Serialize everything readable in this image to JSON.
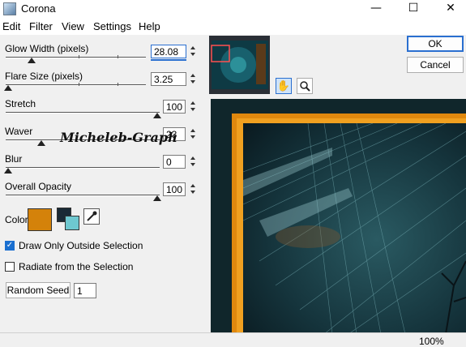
{
  "window": {
    "title": "Corona",
    "minimize_glyph": "—",
    "maximize_glyph": "☐",
    "close_glyph": "✕"
  },
  "menu": [
    "Edit",
    "Filter",
    "View",
    "Settings",
    "Help"
  ],
  "controls": {
    "glow_width": {
      "label": "Glow Width (pixels)",
      "value": "28.08"
    },
    "flare_size": {
      "label": "Flare Size (pixels)",
      "value": "3.25"
    },
    "stretch": {
      "label": "Stretch",
      "value": "100"
    },
    "waver": {
      "label": "Waver",
      "value": "23"
    },
    "blur": {
      "label": "Blur",
      "value": "0"
    },
    "overall_opacity": {
      "label": "Overall Opacity",
      "value": "100"
    }
  },
  "color": {
    "label": "Color",
    "primary": "#d4820a",
    "secondary_dark": "#1a2a36",
    "secondary_light": "#6ec8d0"
  },
  "options": {
    "draw_only_outside": {
      "label": "Draw Only Outside Selection",
      "checked": true
    },
    "radiate_from_selection": {
      "label": "Radiate from the Selection",
      "checked": false
    }
  },
  "random_seed": {
    "button_label": "Random Seed",
    "value": "1"
  },
  "buttons": {
    "ok": "OK",
    "cancel": "Cancel"
  },
  "tools": {
    "hand": "hand-icon",
    "zoom": "magnifier-icon"
  },
  "status": {
    "zoom": "100%"
  },
  "watermark": "Micheleb-Graph"
}
